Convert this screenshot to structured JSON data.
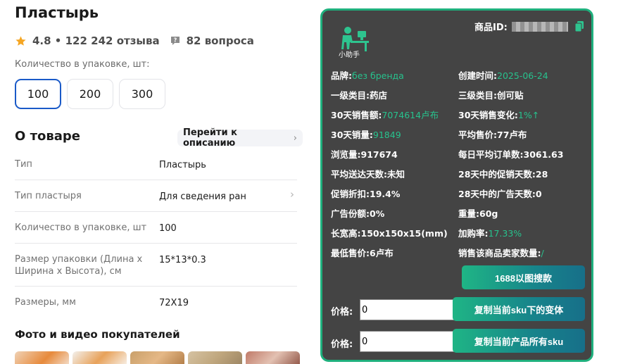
{
  "product": {
    "title": "Пластырь",
    "rating": "4.8",
    "reviews": "122 242 отзыва",
    "questions": "82 вопроса",
    "qty_label": "Количество в упаковке, шт:",
    "qty_options": [
      "100",
      "200",
      "300"
    ],
    "qty_selected": "100"
  },
  "about": {
    "title": "О товаре",
    "goto_label": "Перейти к описанию",
    "specs": [
      {
        "key": "Тип",
        "value": "Пластырь"
      },
      {
        "key": "Тип пластыря",
        "value": "Для сведения ран"
      },
      {
        "key": "Количество в упаковке, шт",
        "value": "100"
      },
      {
        "key": "Размер упаковки (Длина х Ширина х Высота), см",
        "value": "15*13*0.3"
      },
      {
        "key": "Размеры, мм",
        "value": "72X19"
      }
    ]
  },
  "photos": {
    "title": "Фото и видео покупателей"
  },
  "helper": {
    "logo_text": "小助手",
    "product_id_label": "商品ID:",
    "stats": [
      {
        "label": "品牌:",
        "value": "без бренда"
      },
      {
        "label": "创建时间:",
        "value": "2025-06-24"
      },
      {
        "label": "一级类目:",
        "value": "药店"
      },
      {
        "label": "三级类目:",
        "value": "创可贴"
      },
      {
        "label": "30天销售额:",
        "value": "7074614卢布"
      },
      {
        "label": "30天销售变化:",
        "value": "1%↑"
      },
      {
        "label": "30天销量:",
        "value": "91849"
      },
      {
        "label": "平均售价:",
        "value": "77卢布"
      },
      {
        "label": "浏览量:",
        "value": "917674"
      },
      {
        "label": "每日平均订单数:",
        "value": "3061.63"
      },
      {
        "label": "平均送达天数:",
        "value": "未知"
      },
      {
        "label": "28天中的促销天数:",
        "value": "28"
      },
      {
        "label": "促销折扣:",
        "value": "19.4%"
      },
      {
        "label": "28天中的广告天数:",
        "value": "0"
      },
      {
        "label": "广告份额:",
        "value": "0%"
      },
      {
        "label": "重量:",
        "value": "60g"
      },
      {
        "label": "长宽高:",
        "value": "150x150x15(mm)"
      },
      {
        "label": "加购率:",
        "value": "17.33%"
      },
      {
        "label": "最低售价:",
        "value": "6卢布"
      },
      {
        "label": "销售该商品卖家数量:",
        "value": "/"
      }
    ],
    "search_button": "1688以图搜款",
    "price_label": "价格:",
    "price1_value": "0",
    "price2_value": "0",
    "copy_sku_button": "复制当前sku下的变体",
    "copy_all_button": "复制当前产品所有sku"
  },
  "colors": {
    "accent_green": "#27c28d",
    "panel_bg": "#444444",
    "panel_border": "#1fb07d",
    "selected_chip_border": "#1a5ac8",
    "star": "#f5a623"
  }
}
